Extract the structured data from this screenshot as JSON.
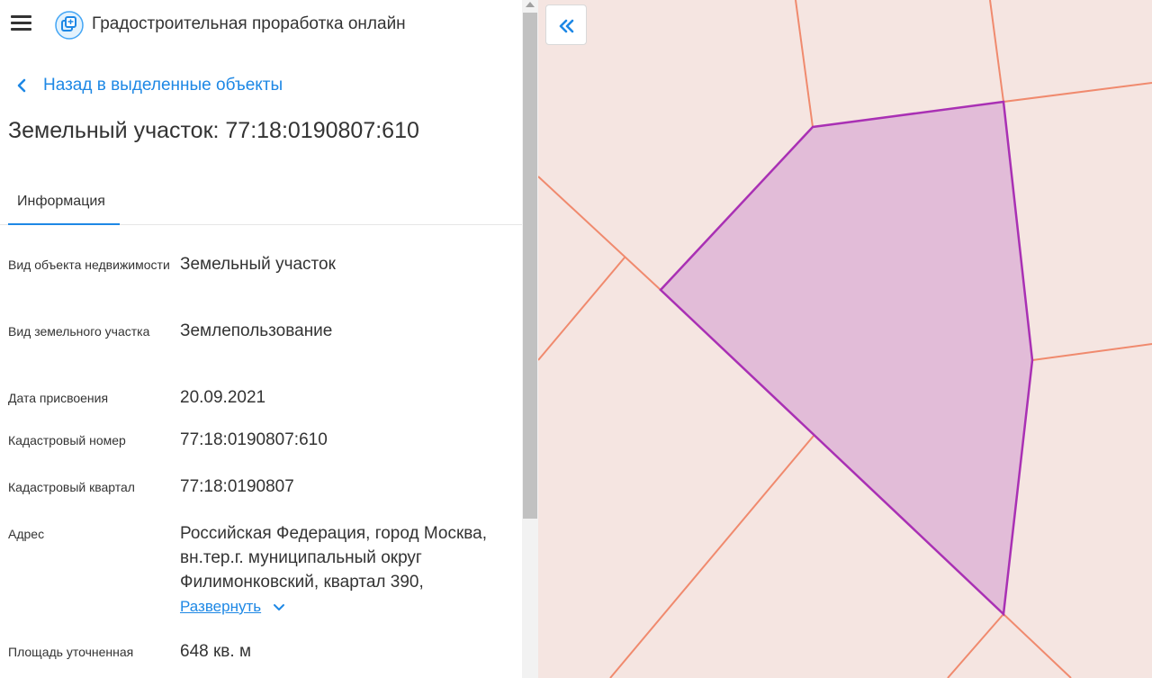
{
  "header": {
    "menu_icon": "hamburger-menu-icon",
    "logo_icon": "layers-logo-icon",
    "title": "Градостроительная проработка онлайн"
  },
  "nav": {
    "back_label": "Назад в выделенные объекты",
    "back_icon": "chevron-left-icon"
  },
  "object": {
    "title": "Земельный участок: 77:18:0190807:610"
  },
  "tabs": [
    {
      "label": "Информация",
      "active": true
    }
  ],
  "info": [
    {
      "label": "Вид объекта недвижимости",
      "value": "Земельный участок"
    },
    {
      "label": "Вид земельного участка",
      "value": "Землепользование"
    },
    {
      "label": "Дата присвоения",
      "value": "20.09.2021"
    },
    {
      "label": "Кадастровый номер",
      "value": "77:18:0190807:610"
    },
    {
      "label": "Кадастровый квартал",
      "value": "77:18:0190807"
    },
    {
      "label": "Адрес",
      "value": "Российская Федерация, город Москва, вн.тер.г. муниципальный округ Филимонковский, квартал 390,"
    },
    {
      "label": "Площадь уточненная",
      "value": "648 кв. м"
    }
  ],
  "address_expand": {
    "label": "Развернуть",
    "icon": "chevron-down-icon"
  },
  "map": {
    "collapse_icon": "double-chevron-left-icon",
    "background_color": "#f5e5e1",
    "parcel_line_color": "#f08a6e",
    "selected_fill_color": "#e2bcd8",
    "selected_stroke_color": "#a930b4"
  },
  "colors": {
    "accent": "#1e88e5",
    "text": "#333333"
  }
}
